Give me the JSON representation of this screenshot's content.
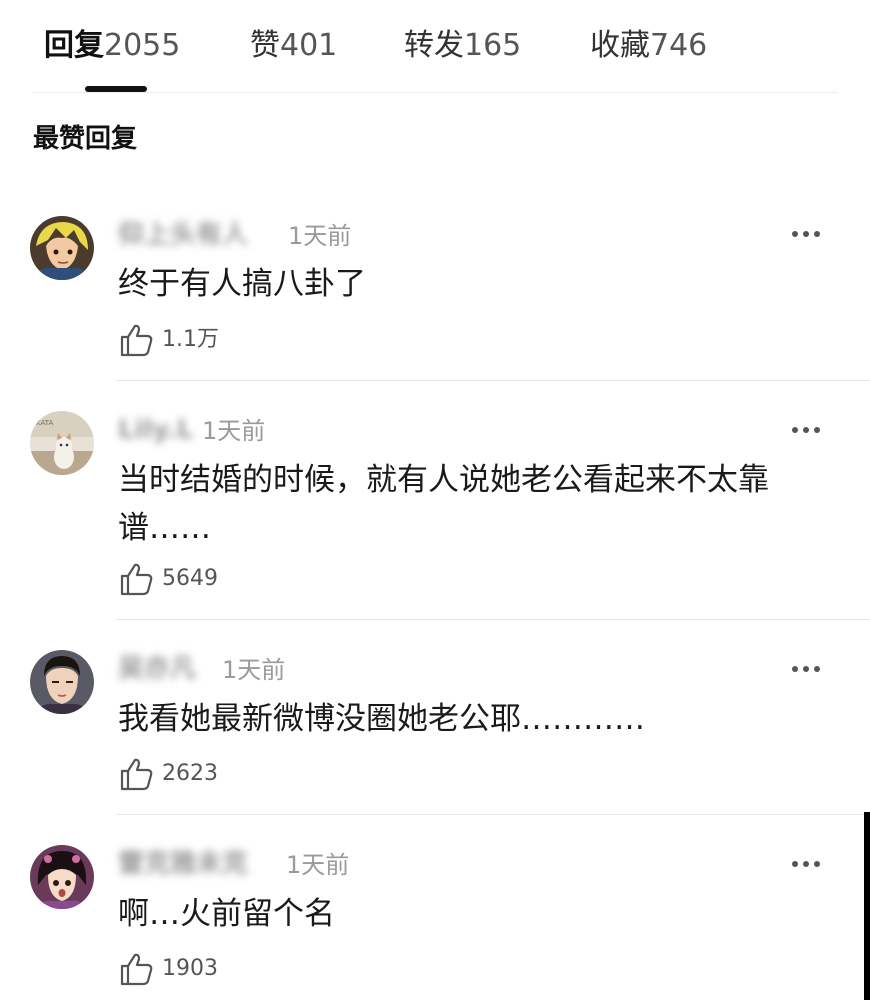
{
  "tabs": [
    {
      "label": "回复",
      "count": "2055",
      "active": true
    },
    {
      "label": "赞",
      "count": "401",
      "active": false
    },
    {
      "label": "转发",
      "count": "165",
      "active": false
    },
    {
      "label": "收藏",
      "count": "746",
      "active": false
    }
  ],
  "section_title": "最赞回复",
  "comments": [
    {
      "username": "仰上头有人",
      "time": "1天前",
      "text": "终于有人搞八卦了",
      "likes": "1.1万",
      "avatar": "anime-boy-avatar"
    },
    {
      "username": "Lily.L",
      "time": "1天前",
      "text": "当时结婚的时候，就有人说她老公看起来不太靠谱……",
      "likes": "5649",
      "avatar": "cat-avatar"
    },
    {
      "username": "吴亦凡",
      "time": "1天前",
      "text": "我看她最新微博没圈她老公耶…………",
      "likes": "2623",
      "avatar": "man-avatar"
    },
    {
      "username": "雷克雅未克",
      "time": "1天前",
      "text": "啊…火前留个名",
      "likes": "1903",
      "avatar": "drama-girl-avatar"
    }
  ],
  "icons": {
    "more": "more-dots-icon",
    "like": "thumbs-up-icon"
  },
  "colors": {
    "text_primary": "#1a1a1a",
    "text_secondary": "#9a9a9a",
    "active_underline": "#111111"
  }
}
